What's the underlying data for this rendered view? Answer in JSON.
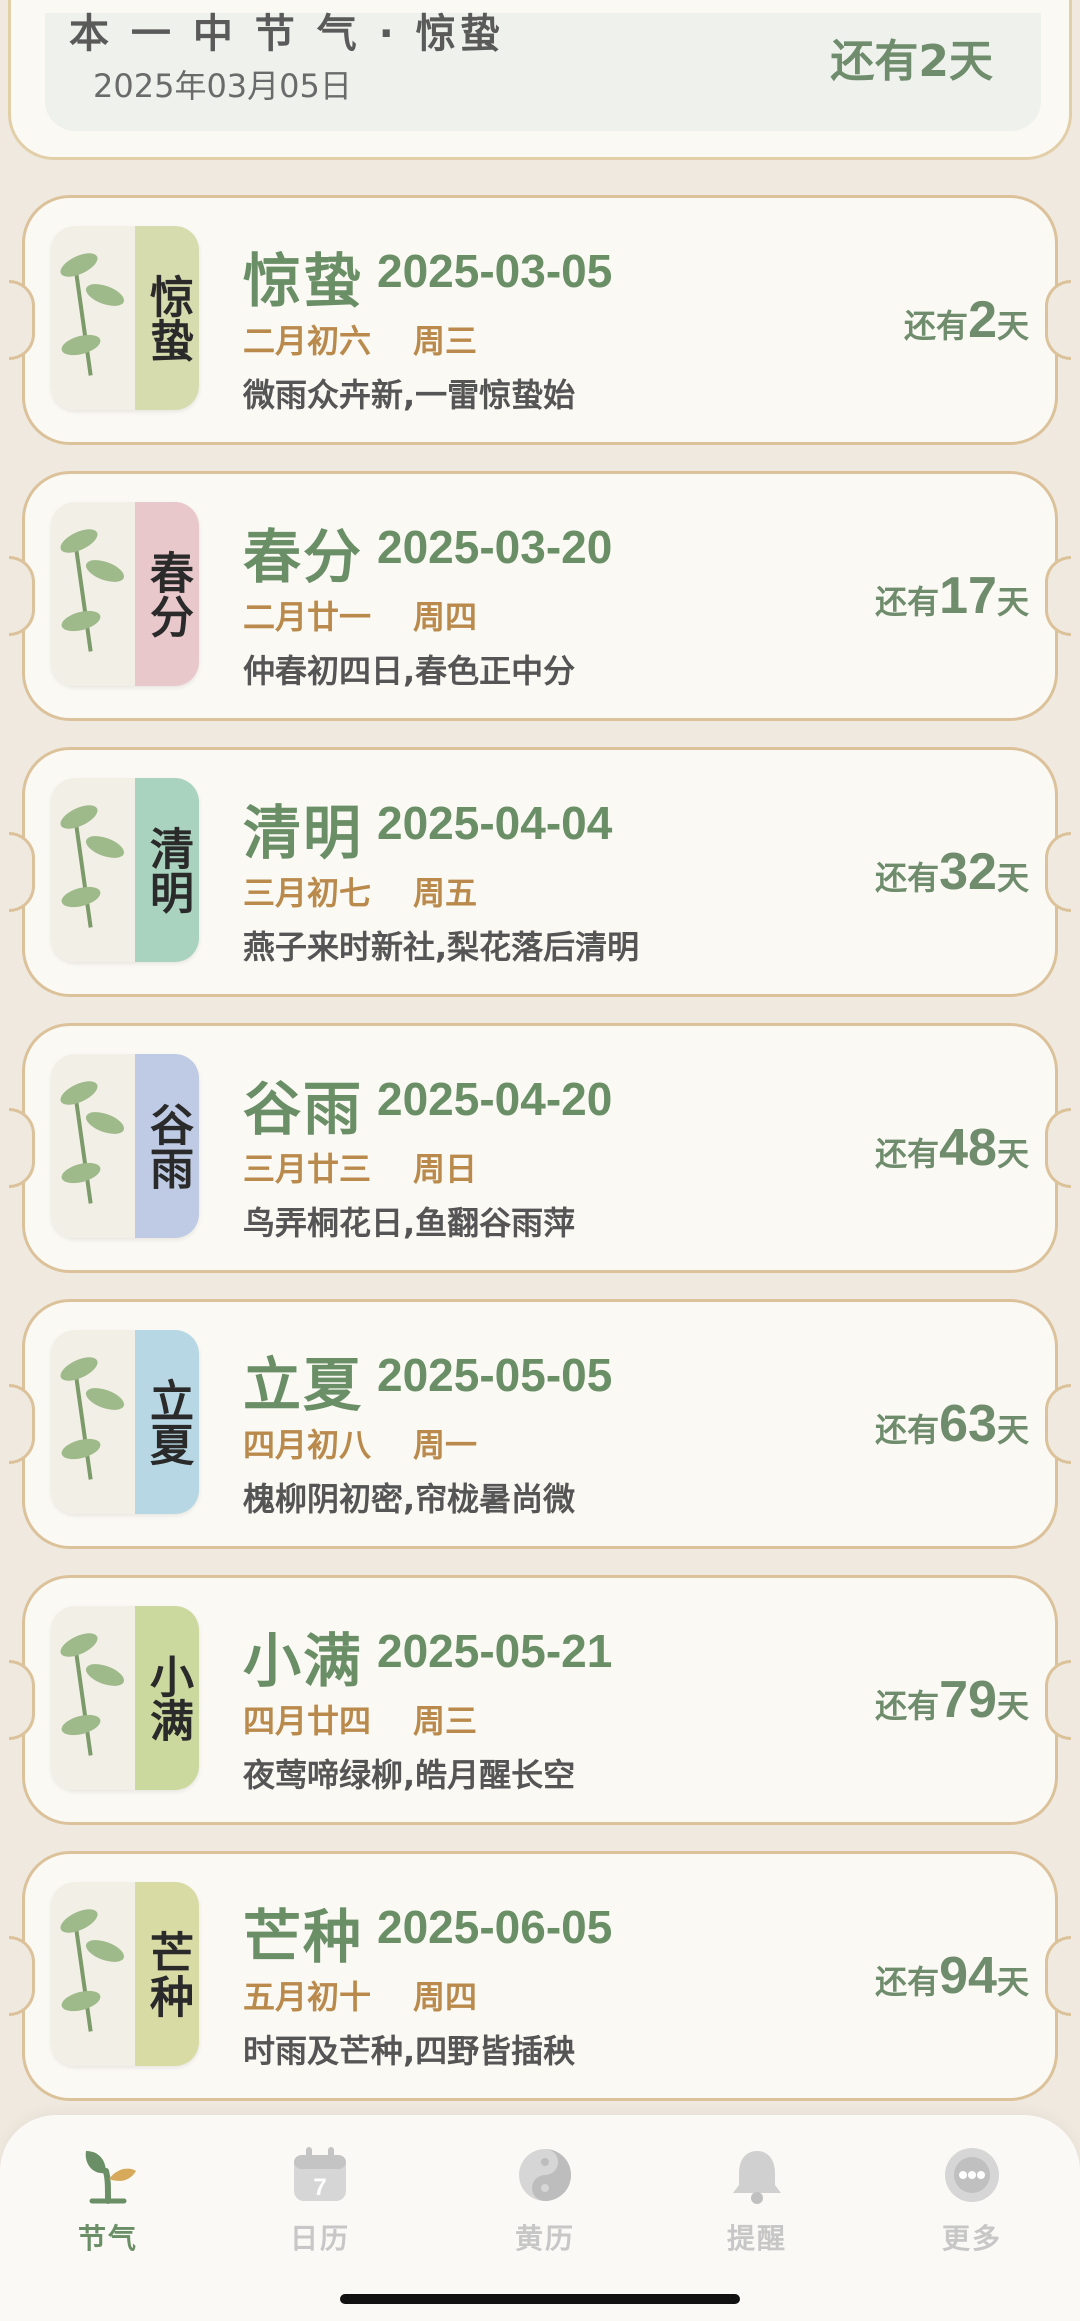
{
  "top_card": {
    "title": "本 一 中 节 气 · 惊蛰",
    "date": "2025年03月05日",
    "countdown": "还有2天"
  },
  "terms": [
    {
      "name": "惊蛰",
      "date": "2025-03-05",
      "lunar": "二月初六",
      "weekday": "周三",
      "poem": "微雨众卉新,一雷惊蛰始",
      "pre": "还有",
      "days": "2",
      "suf": "天",
      "thumb_text": "惊蛰",
      "band_color": "#d7dcae"
    },
    {
      "name": "春分",
      "date": "2025-03-20",
      "lunar": "二月廿一",
      "weekday": "周四",
      "poem": "仲春初四日,春色正中分",
      "pre": "还有",
      "days": "17",
      "suf": "天",
      "thumb_text": "春分",
      "band_color": "#e9c8cc"
    },
    {
      "name": "清明",
      "date": "2025-04-04",
      "lunar": "三月初七",
      "weekday": "周五",
      "poem": "燕子来时新社,梨花落后清明",
      "pre": "还有",
      "days": "32",
      "suf": "天",
      "thumb_text": "清明",
      "band_color": "#a9d3bf"
    },
    {
      "name": "谷雨",
      "date": "2025-04-20",
      "lunar": "三月廿三",
      "weekday": "周日",
      "poem": "鸟弄桐花日,鱼翻谷雨萍",
      "pre": "还有",
      "days": "48",
      "suf": "天",
      "thumb_text": "谷雨",
      "band_color": "#bfcbe4"
    },
    {
      "name": "立夏",
      "date": "2025-05-05",
      "lunar": "四月初八",
      "weekday": "周一",
      "poem": "槐柳阴初密,帘栊暑尚微",
      "pre": "还有",
      "days": "63",
      "suf": "天",
      "thumb_text": "立夏",
      "band_color": "#b6d7e3"
    },
    {
      "name": "小满",
      "date": "2025-05-21",
      "lunar": "四月廿四",
      "weekday": "周三",
      "poem": "夜莺啼绿柳,皓月醒长空",
      "pre": "还有",
      "days": "79",
      "suf": "天",
      "thumb_text": "小满",
      "band_color": "#cbd89e"
    },
    {
      "name": "芒种",
      "date": "2025-06-05",
      "lunar": "五月初十",
      "weekday": "周四",
      "poem": "时雨及芒种,四野皆插秧",
      "pre": "还有",
      "days": "94",
      "suf": "天",
      "thumb_text": "芒种",
      "band_color": "#d9dba4"
    }
  ],
  "tabs": [
    {
      "label": "节气",
      "icon": "sprout-icon",
      "active": true
    },
    {
      "label": "日历",
      "icon": "calendar-icon",
      "active": false
    },
    {
      "label": "黄历",
      "icon": "yin-yang-icon",
      "active": false
    },
    {
      "label": "提醒",
      "icon": "bell-icon",
      "active": false
    },
    {
      "label": "更多",
      "icon": "more-icon",
      "active": false
    }
  ],
  "colors": {
    "accent": "#6a8f66",
    "lunar": "#b98a4b",
    "background": "#efe9df",
    "border": "#dcc29a"
  }
}
